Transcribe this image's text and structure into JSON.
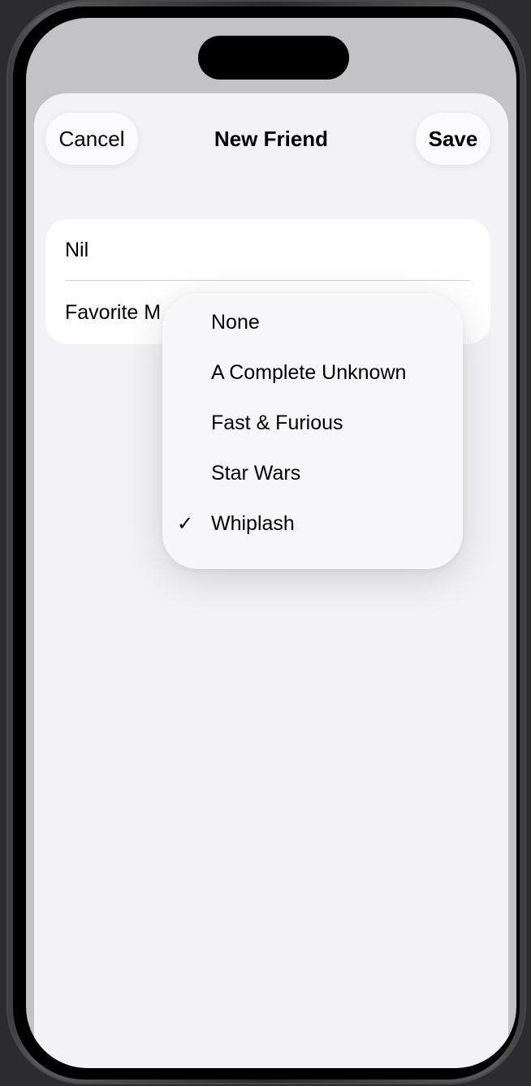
{
  "navigation": {
    "cancel_label": "Cancel",
    "title": "New Friend",
    "save_label": "Save"
  },
  "form": {
    "name_value": "Nil",
    "favorite_movie_label": "Favorite M"
  },
  "menu": {
    "items": [
      {
        "label": "None",
        "checked": false
      },
      {
        "label": "A Complete Unknown",
        "checked": false
      },
      {
        "label": "Fast & Furious",
        "checked": false
      },
      {
        "label": "Star Wars",
        "checked": false
      },
      {
        "label": "Whiplash",
        "checked": true
      }
    ],
    "check_glyph": "✓"
  },
  "icons": {
    "checkmark": "checkmark-icon"
  }
}
